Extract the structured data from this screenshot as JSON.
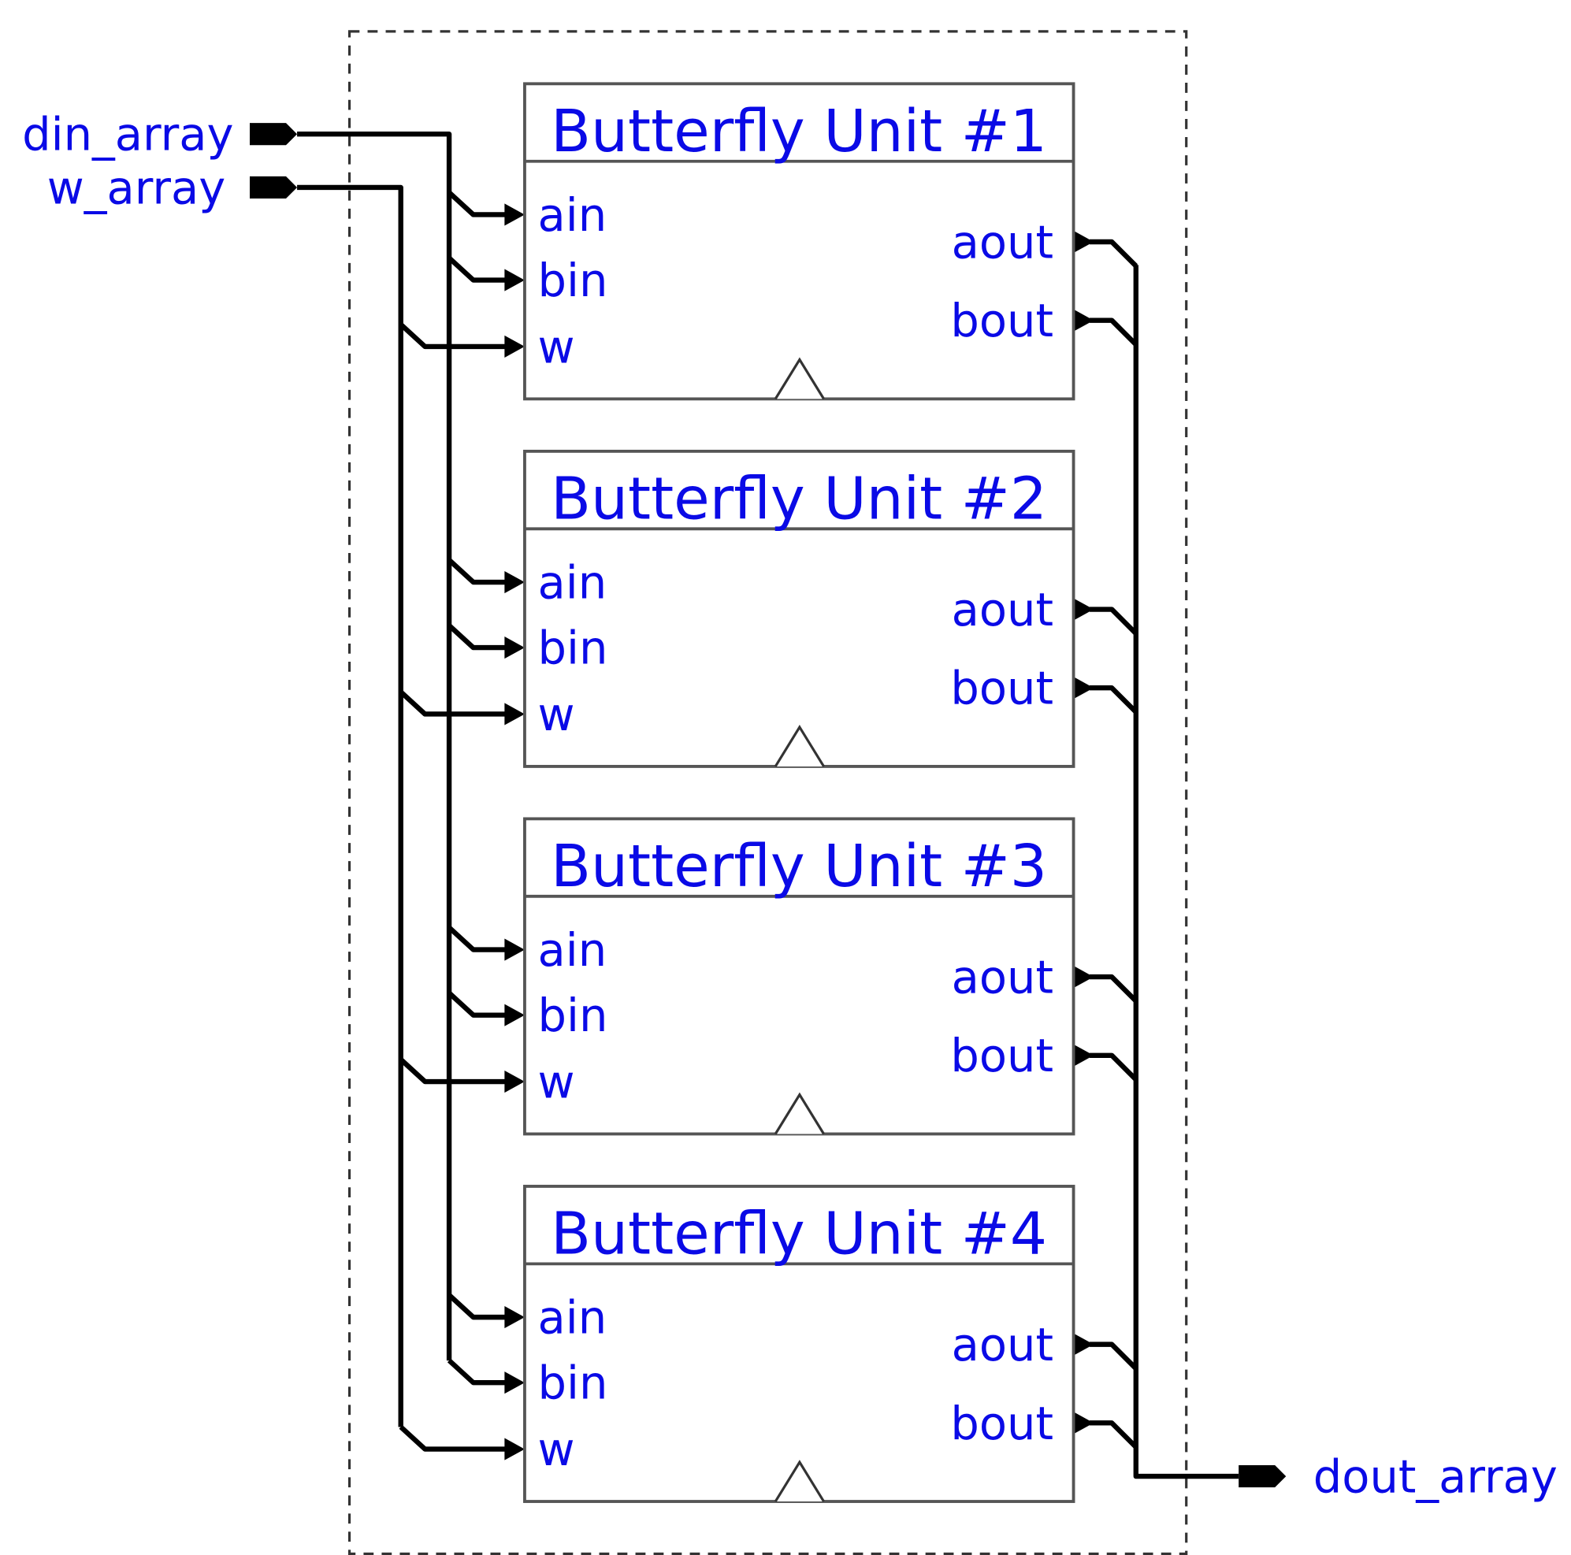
{
  "inputs": {
    "din": "din_array",
    "w": "w_array"
  },
  "output": {
    "dout": "dout_array"
  },
  "units": [
    {
      "title": "Butterfly Unit #1",
      "inputs": [
        "ain",
        "bin",
        "w"
      ],
      "outputs": [
        "aout",
        "bout"
      ]
    },
    {
      "title": "Butterfly Unit #2",
      "inputs": [
        "ain",
        "bin",
        "w"
      ],
      "outputs": [
        "aout",
        "bout"
      ]
    },
    {
      "title": "Butterfly Unit #3",
      "inputs": [
        "ain",
        "bin",
        "w"
      ],
      "outputs": [
        "aout",
        "bout"
      ]
    },
    {
      "title": "Butterfly Unit #4",
      "inputs": [
        "ain",
        "bin",
        "w"
      ],
      "outputs": [
        "aout",
        "bout"
      ]
    }
  ],
  "colors": {
    "label": "#0a0ae6",
    "wire": "#000000",
    "box_border": "#555555"
  }
}
